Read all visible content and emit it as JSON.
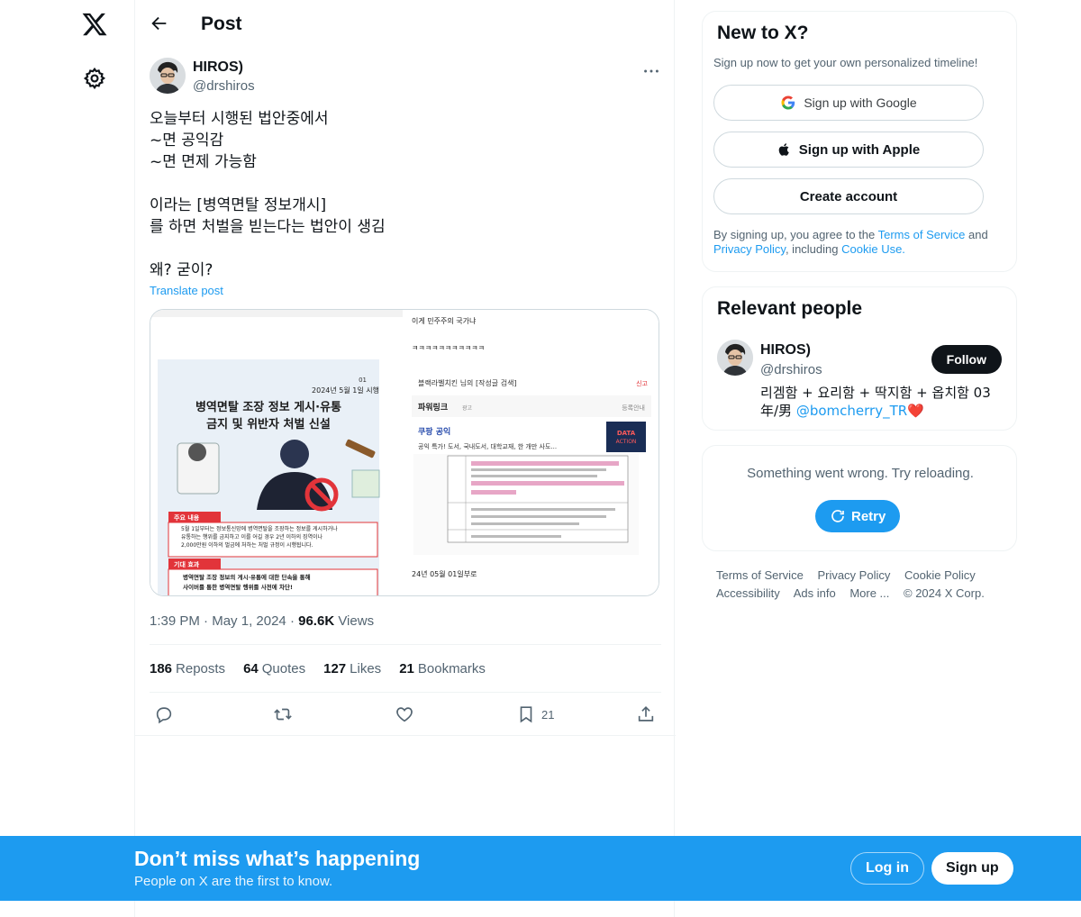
{
  "nav": {
    "logo_icon": "x-logo-icon",
    "settings_icon": "gear-icon"
  },
  "header": {
    "title": "Post"
  },
  "post": {
    "author_name": "HIROS)",
    "author_handle": "@drshiros",
    "text": "오늘부터 시행된 법안중에서\n~면 공익감\n~면 면제 가능함\n\n이라는 [병역면탈 정보개시]\n를 하면 처벌을 빋는다는 법안이 생김\n\n왜? 굳이?",
    "translate_label": "Translate post",
    "media": {
      "left_date": "2024년 5월 1일 시행",
      "left_title": "병역면탈 조장 정보 게시·유통\n금지 및 위반자 처벌 신설",
      "left_tag1": "주요 내용",
      "left_body1": "5월 1일부터는 정보통신망에 병역면탈을 조장하는 정보를 게시하거나 유통하는 행위를 금지하고 이를 어길 경우 2년 이하의 징역이나 2,000만원 이하의 벌금에 처하는 처벌 규정이 시행됩니다.",
      "left_tag2": "기대 효과",
      "left_body2": "병역면탈 조장 정보의 게시·유통에 대한 단속을 통해 사이버를 통한 병역면탈 행위를 사전에 차단!",
      "right_line1": "이게 민주주의 국가냐",
      "right_line2": "ㅋㅋㅋㅋㅋㅋㅋㅋㅋㅋㅋ",
      "right_line3": "블랙라벨치킨 님의 [작성글 검색]",
      "right_report": "신고",
      "right_powerlink": "파워링크",
      "right_ad": "광고",
      "right_register": "등록안내",
      "right_link": "쿠팡 공익",
      "right_link_desc": "공익 특가! 도서, 국내도서, 대학교재, 한 개만 사도...",
      "right_data_action": "DATA ACTION",
      "right_date": "24년 05월 01일부로"
    },
    "time": "1:39 PM",
    "date": "May 1, 2024",
    "views_count": "96.6K",
    "views_label": "Views",
    "reposts_count": "186",
    "reposts_label": "Reposts",
    "quotes_count": "64",
    "quotes_label": "Quotes",
    "likes_count": "127",
    "likes_label": "Likes",
    "bookmarks_count": "21",
    "bookmarks_label": "Bookmarks",
    "bookmark_action_count": "21"
  },
  "sidebar": {
    "new_title": "New to X?",
    "new_sub": "Sign up now to get your own personalized timeline!",
    "google_label": "Sign up with Google",
    "apple_label": "Sign up with Apple",
    "create_label": "Create account",
    "legal_1": "By signing up, you agree to the ",
    "legal_terms": "Terms of Service",
    "legal_2": " and ",
    "legal_privacy": "Privacy Policy",
    "legal_3": ", including ",
    "legal_cookie": "Cookie Use.",
    "relevant_title": "Relevant people",
    "rp_name": "HIROS)",
    "rp_handle": "@drshiros",
    "follow_label": "Follow",
    "rp_bio_1": "리겜함 + 요리함 + 딱지함 + 옵치함 03年/男 ",
    "rp_bio_mention": "@bomcherry_TR",
    "rp_bio_heart": "❤️",
    "error_text": "Something went wrong. Try reloading.",
    "retry_label": "Retry"
  },
  "footer": {
    "terms": "Terms of Service",
    "privacy": "Privacy Policy",
    "cookie": "Cookie Policy",
    "accessibility": "Accessibility",
    "ads": "Ads info",
    "more": "More ...",
    "copyright": "© 2024 X Corp."
  },
  "bottom": {
    "title": "Don’t miss what’s happening",
    "subtitle": "People on X are the first to know.",
    "login_label": "Log in",
    "signup_label": "Sign up"
  },
  "colors": {
    "accent": "#1d9bf0",
    "text": "#0f1419",
    "muted": "#536471"
  }
}
